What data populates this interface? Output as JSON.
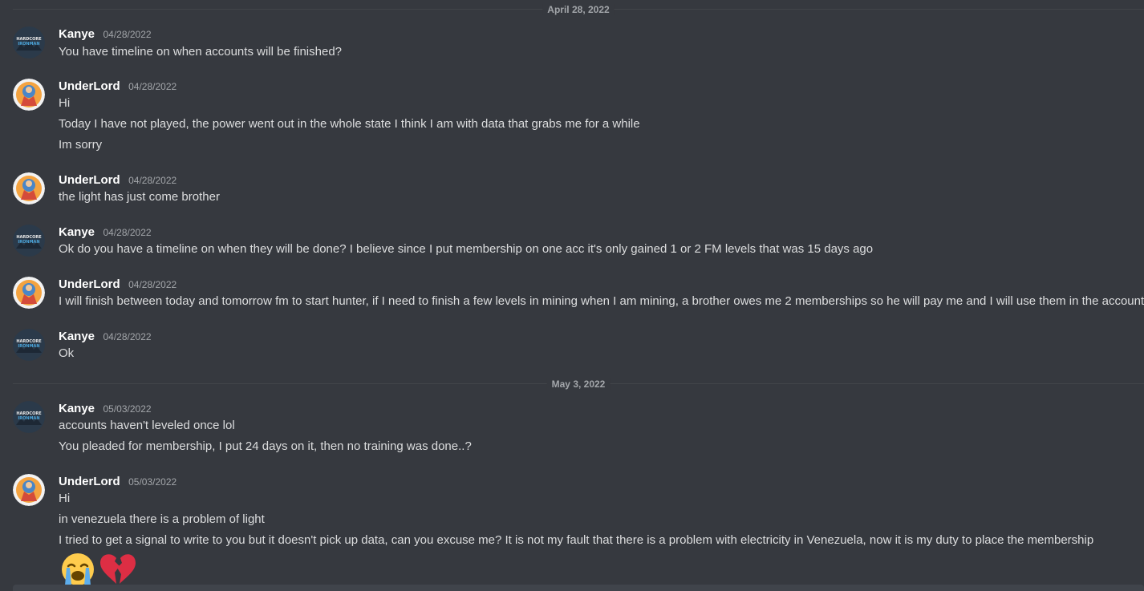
{
  "dividers": {
    "d1": "April 28, 2022",
    "d2": "May 3, 2022"
  },
  "avatars": {
    "kanye_text_top": "HARDCORE",
    "kanye_text_bottom": "IRONMAN"
  },
  "messages": [
    {
      "author": "Kanye",
      "timestamp": "04/28/2022",
      "lines": [
        "You have timeline on when accounts will be finished?"
      ]
    },
    {
      "author": "UnderLord",
      "timestamp": "04/28/2022",
      "lines": [
        "Hi",
        "Today I have not played, the power went out in the whole state I think I am with data that grabs me for a while",
        "Im sorry"
      ]
    },
    {
      "author": "UnderLord",
      "timestamp": "04/28/2022",
      "lines": [
        "the light has just come brother"
      ]
    },
    {
      "author": "Kanye",
      "timestamp": "04/28/2022",
      "lines": [
        "Ok do you have a timeline on when they will be done? I believe since I put membership on one acc it's only gained 1 or 2 FM levels that was 15 days ago"
      ]
    },
    {
      "author": "UnderLord",
      "timestamp": "04/28/2022",
      "lines": [
        "I will finish between today and tomorrow fm to start hunter, if I need to finish a few levels in mining when I am mining, a brother owes me 2 memberships so he will pay me and I will use them in the accounts"
      ]
    },
    {
      "author": "Kanye",
      "timestamp": "04/28/2022",
      "lines": [
        "Ok"
      ]
    },
    {
      "author": "Kanye",
      "timestamp": "05/03/2022",
      "lines": [
        "accounts haven't leveled once lol",
        "You pleaded for membership, I put 24 days on it, then no training was done..?"
      ]
    },
    {
      "author": "UnderLord",
      "timestamp": "05/03/2022",
      "lines": [
        "Hi",
        "in venezuela there is a problem of light",
        "I tried to get a signal to write to you but it doesn't pick up data, can you excuse me? It is not my fault that there is a problem with electricity in Venezuela, now it is my duty to place the membership"
      ]
    }
  ],
  "emojis": [
    "loudly-crying-face",
    "broken-heart"
  ],
  "colors": {
    "background": "#36393f",
    "username": "#ffffff",
    "text": "#dcddde",
    "muted": "#a3a6aa"
  }
}
